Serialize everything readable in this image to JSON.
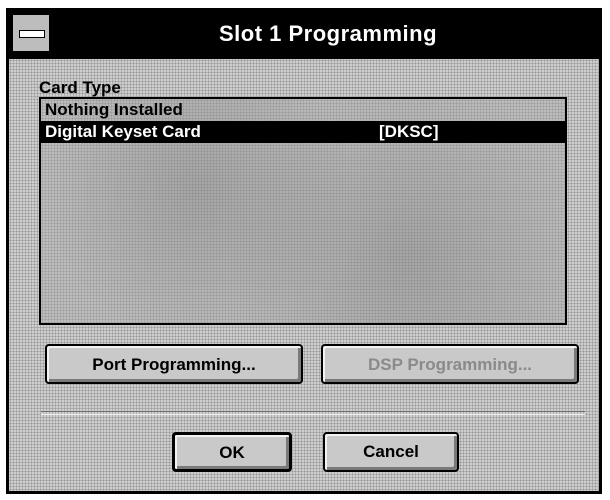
{
  "window": {
    "title": "Slot 1 Programming"
  },
  "card_type": {
    "label": "Card Type",
    "items": [
      {
        "name": "Nothing Installed",
        "code": "",
        "selected": false
      },
      {
        "name": "Digital Keyset Card",
        "code": "[DKSC]",
        "selected": true
      }
    ]
  },
  "buttons": {
    "port_programming": "Port Programming...",
    "dsp_programming": "DSP Programming...",
    "ok": "OK",
    "cancel": "Cancel"
  }
}
